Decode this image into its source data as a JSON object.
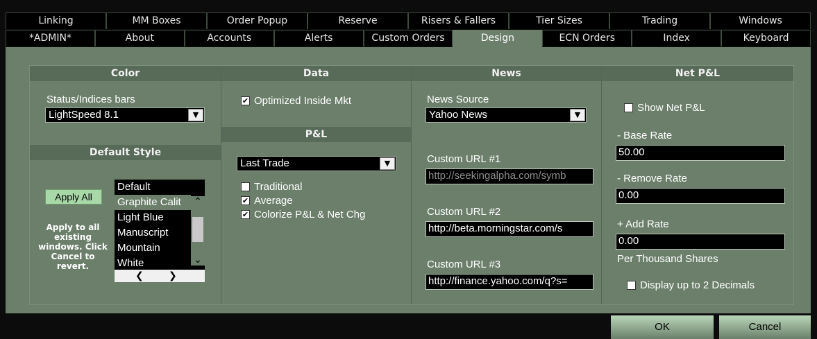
{
  "tabs_row1": [
    "Linking",
    "MM Boxes",
    "Order Popup",
    "Reserve",
    "Risers & Fallers",
    "Tier Sizes",
    "Trading",
    "Windows"
  ],
  "tabs_row2": [
    "*ADMIN*",
    "About",
    "Accounts",
    "Alerts",
    "Custom Orders",
    "Design",
    "ECN Orders",
    "Index",
    "Keyboard"
  ],
  "active_tab": "Design",
  "color": {
    "header": "Color",
    "status_label": "Status/Indices bars",
    "status_value": "LightSpeed 8.1"
  },
  "default_style": {
    "header": "Default Style",
    "apply_all": "Apply All",
    "note": "Apply to all existing windows. Click Cancel to revert.",
    "styles": [
      "Default",
      "Graphite Calit",
      "Light Blue",
      "Manuscript",
      "Mountain",
      "White"
    ],
    "selected_index": 1
  },
  "data": {
    "header": "Data",
    "optimized_label": "Optimized Inside Mkt",
    "optimized_checked": true
  },
  "pnl": {
    "header": "P&L",
    "mode_value": "Last Trade",
    "traditional_label": "Traditional",
    "traditional_checked": false,
    "average_label": "Average",
    "average_checked": true,
    "colorize_label": "Colorize P&L & Net Chg",
    "colorize_checked": true
  },
  "news": {
    "header": "News",
    "source_label": "News Source",
    "source_value": "Yahoo News",
    "url1_label": "Custom URL #1",
    "url1_value": "http://seekingalpha.com/symb",
    "url2_label": "Custom URL #2",
    "url2_value": "http://beta.morningstar.com/s",
    "url3_label": "Custom URL #3",
    "url3_value": "http://finance.yahoo.com/q?s="
  },
  "net_pnl": {
    "header": "Net P&L",
    "show_label": "Show Net P&L",
    "show_checked": false,
    "base_label": "- Base Rate",
    "base_value": "50.00",
    "remove_label": "- Remove Rate",
    "remove_value": "0.00",
    "add_label": "+ Add Rate",
    "add_value": "0.00",
    "per_label": "Per Thousand Shares",
    "decimals_label": "Display up to 2 Decimals",
    "decimals_checked": false
  },
  "buttons": {
    "ok": "OK",
    "cancel": "Cancel"
  },
  "colors": {
    "panel": "#6b7f6b",
    "section_header": "#586a58",
    "tab_bg": "#000000",
    "button": "#a8d8a8"
  }
}
